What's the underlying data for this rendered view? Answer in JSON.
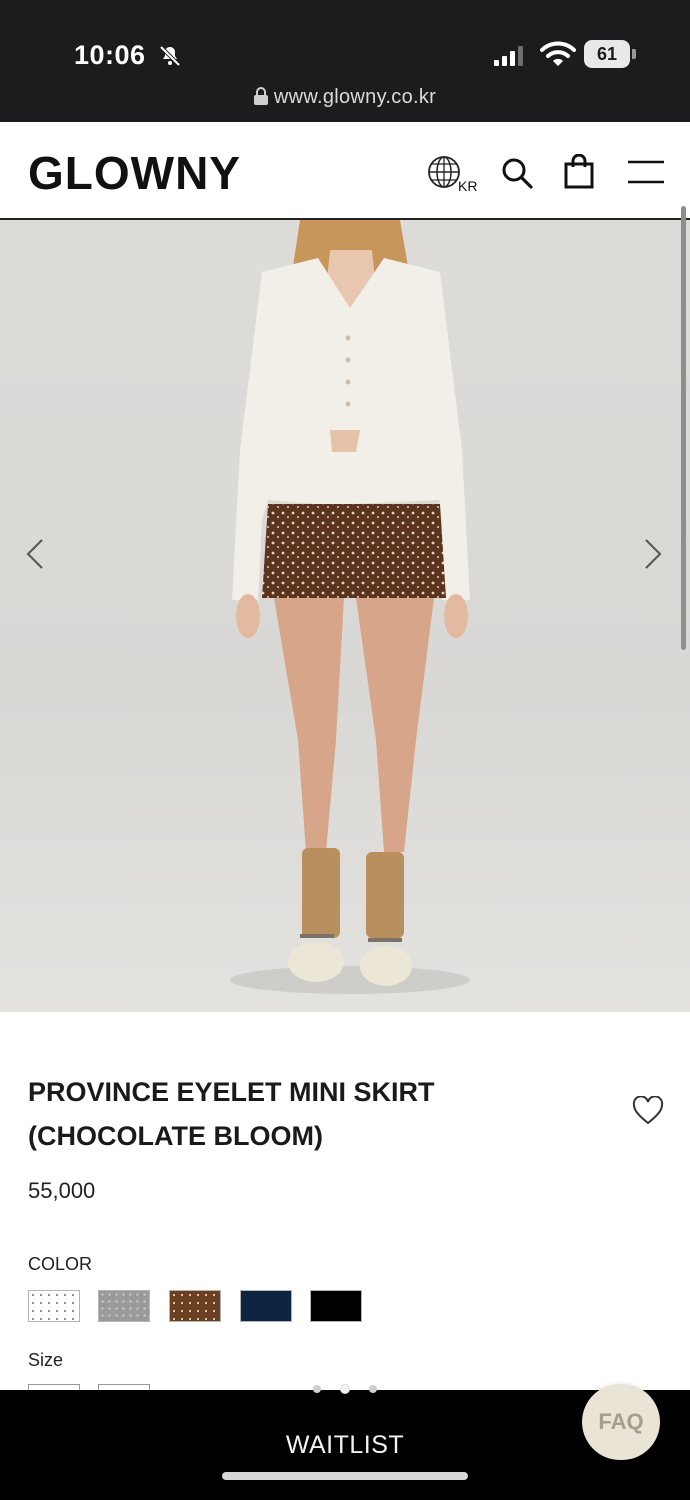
{
  "status_bar": {
    "time": "10:06",
    "battery": "61",
    "url": "www.glowny.co.kr",
    "icons": [
      "bell-off-icon",
      "signal-icon",
      "wifi-icon",
      "battery-icon",
      "lock-icon"
    ]
  },
  "header": {
    "logo": "GLOWNY",
    "region": "KR",
    "icons": [
      "close-icon",
      "globe-icon",
      "search-icon",
      "shopping-bag-icon",
      "menu-icon"
    ]
  },
  "gallery": {
    "icons": [
      "chevron-left-icon",
      "chevron-right-icon"
    ],
    "active_slide_index": 1,
    "slide_count": 3
  },
  "product": {
    "title_line1": "PROVINCE EYELET MINI SKIRT",
    "title_line2": "(CHOCOLATE BLOOM)",
    "price": "55,000",
    "color_label": "COLOR",
    "size_label": "Size",
    "swatch_colors": [
      "#ffffff",
      "#9a9a9a",
      "#6b3f22",
      "#0f2442",
      "#000000"
    ]
  },
  "footer": {
    "waitlist_label": "WAITLIST",
    "faq_label": "FAQ"
  },
  "colors": {
    "status_bar_bg": "#1c1c1e",
    "bottom_bar_bg": "#000000",
    "faq_bg": "#e9e4d6"
  }
}
